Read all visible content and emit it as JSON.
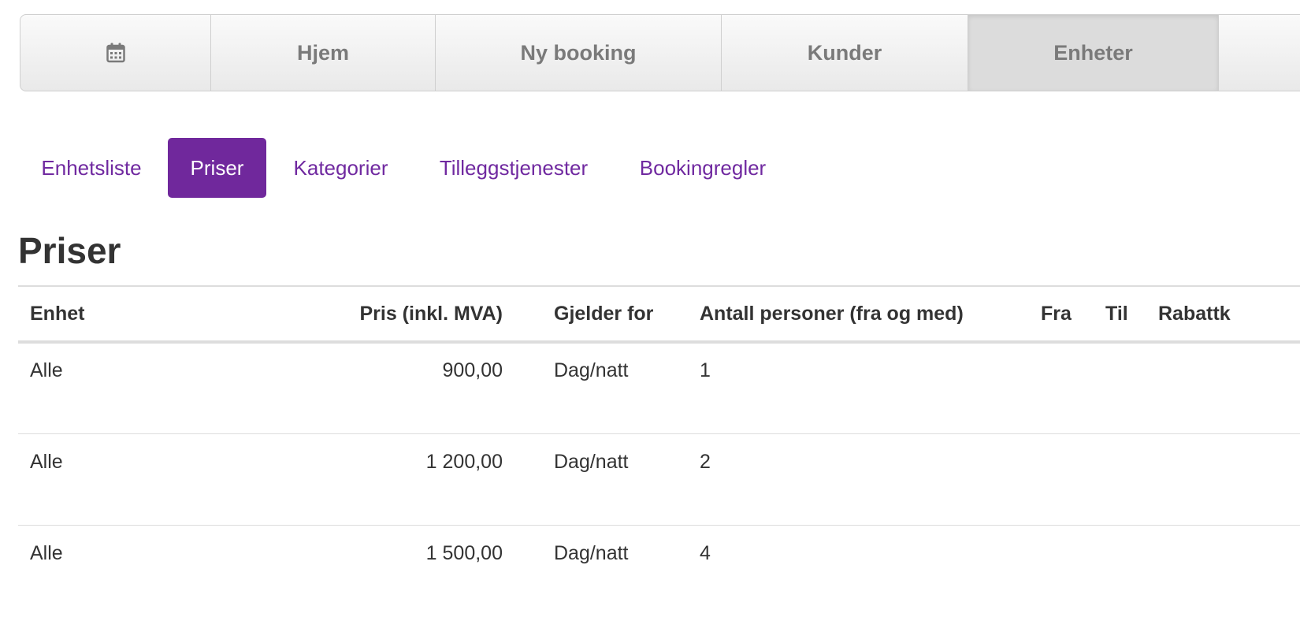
{
  "topnav": {
    "calendar_icon": "calendar-icon",
    "items": [
      {
        "label": "Hjem"
      },
      {
        "label": "Ny booking"
      },
      {
        "label": "Kunder"
      },
      {
        "label": "Enheter",
        "active": true
      }
    ]
  },
  "subnav": {
    "tabs": [
      {
        "label": "Enhetsliste"
      },
      {
        "label": "Priser",
        "active": true
      },
      {
        "label": "Kategorier"
      },
      {
        "label": "Tilleggstjenester"
      },
      {
        "label": "Bookingregler"
      }
    ]
  },
  "page": {
    "title": "Priser"
  },
  "table": {
    "headers": {
      "unit": "Enhet",
      "price": "Pris (inkl. MVA)",
      "applies_to": "Gjelder for",
      "persons": "Antall personer (fra og med)",
      "from": "Fra",
      "to": "Til",
      "discount": "Rabattk"
    },
    "rows": [
      {
        "unit": "Alle",
        "price": "900,00",
        "applies_to": "Dag/natt",
        "persons": "1"
      },
      {
        "unit": "Alle",
        "price": "1 200,00",
        "applies_to": "Dag/natt",
        "persons": "2"
      },
      {
        "unit": "Alle",
        "price": "1 500,00",
        "applies_to": "Dag/natt",
        "persons": "4"
      }
    ]
  },
  "colors": {
    "accent": "#70289c",
    "nav_text": "#7a7a7a",
    "text": "#333333",
    "border": "#dddddd"
  }
}
